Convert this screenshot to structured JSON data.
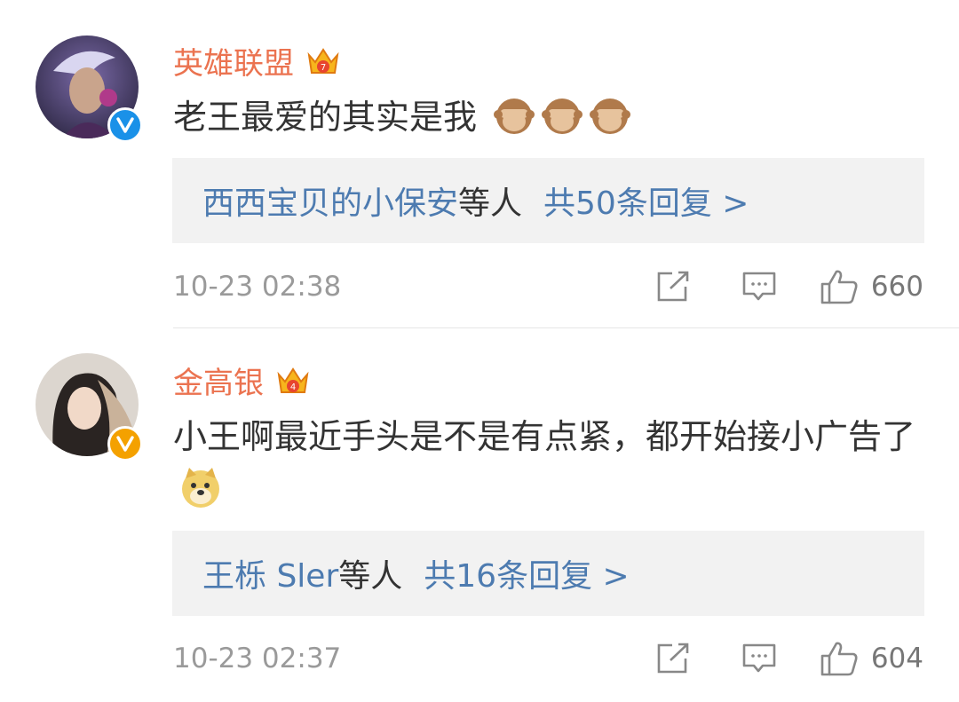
{
  "comments": [
    {
      "username": "英雄联盟",
      "text": "老王最爱的其实是我",
      "crown_level": "7",
      "verified_color": "#1a91e8",
      "reply_users": "西西宝贝的小保安",
      "reply_etc": "等人",
      "reply_count_text": "共50条回复 >",
      "timestamp": "10-23 02:38",
      "likes": "660"
    },
    {
      "username": "金高银",
      "text": "小王啊最近手头是不是有点紧，都开始接小广告了",
      "crown_level": "4",
      "verified_color": "#f4a100",
      "reply_users": "王栎 Sler",
      "reply_etc": "等人",
      "reply_count_text": "共16条回复 >",
      "timestamp": "10-23 02:37",
      "likes": "604"
    }
  ],
  "colors": {
    "username": "#eb7350",
    "reply_link": "#4d7bb0",
    "reply_bg": "#f2f2f2"
  },
  "icons": {
    "share": "share-icon",
    "comment": "comment-icon",
    "like": "thumbs-up-icon",
    "crown": "crown-icon",
    "verified": "verified-v-icon",
    "emoji_1": "see-no-evil-monkey-icon",
    "emoji_2": "doge-icon"
  }
}
